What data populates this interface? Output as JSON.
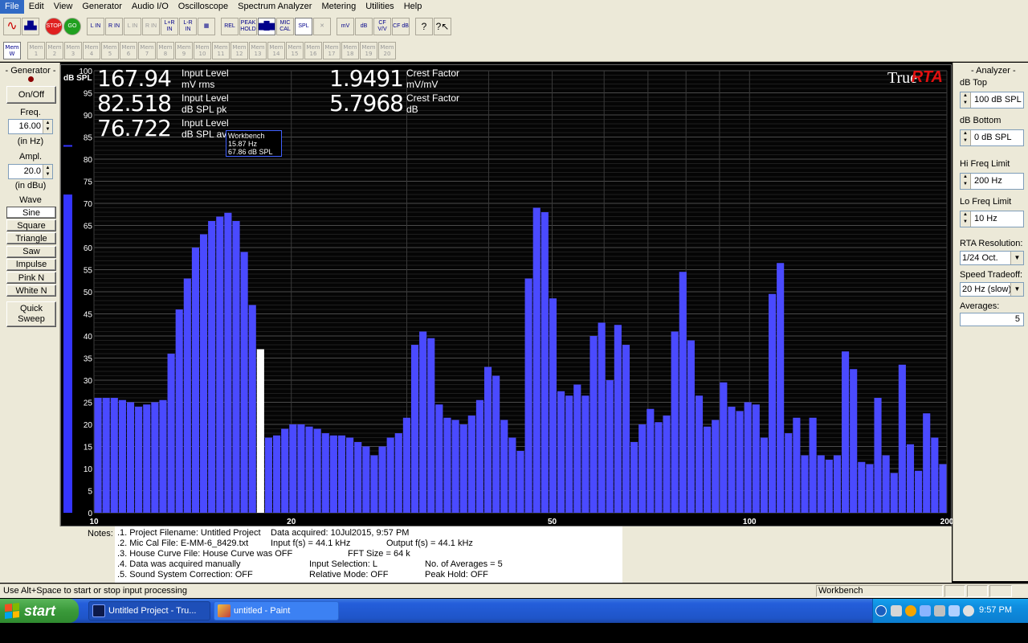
{
  "menu": [
    "File",
    "Edit",
    "View",
    "Generator",
    "Audio I/O",
    "Oscilloscope",
    "Spectrum Analyzer",
    "Metering",
    "Utilities",
    "Help"
  ],
  "toolbar": {
    "row1": [
      {
        "name": "sine-wave-icon",
        "label": "∿",
        "state": "normal"
      },
      {
        "name": "spectrum-icon",
        "label": "▟▙",
        "state": "normal"
      },
      {
        "sep": true
      },
      {
        "name": "stop-icon",
        "label": "STOP",
        "state": "normal"
      },
      {
        "name": "go-icon",
        "label": "GO",
        "state": "normal"
      },
      {
        "sep": true
      },
      {
        "name": "left-input-icon",
        "label": "L IN",
        "state": "normal"
      },
      {
        "name": "right-input-icon",
        "label": "R IN",
        "state": "normal"
      },
      {
        "name": "left-input-alt-icon",
        "label": "L IN",
        "state": "disabled"
      },
      {
        "name": "right-input-alt-icon",
        "label": "R IN",
        "state": "disabled"
      },
      {
        "name": "l-plus-r-input-icon",
        "label": "L+R IN",
        "state": "normal"
      },
      {
        "name": "l-minus-r-input-icon",
        "label": "L-R IN",
        "state": "normal"
      },
      {
        "name": "grid-icon",
        "label": "▦",
        "state": "normal"
      },
      {
        "sep": true
      },
      {
        "name": "relative-icon",
        "label": "REL",
        "state": "normal"
      },
      {
        "name": "peak-hold-icon",
        "label": "PEAK HOLD",
        "state": "normal"
      },
      {
        "name": "bar-graph-icon",
        "label": "▆█▆",
        "state": "pressed"
      },
      {
        "name": "mic-cal-icon",
        "label": "MIC CAL",
        "state": "normal"
      },
      {
        "name": "spl-icon",
        "label": "SPL",
        "state": "pressed"
      },
      {
        "name": "clear-icon",
        "label": "✕",
        "state": "disabled"
      },
      {
        "sep": true
      },
      {
        "name": "millivolt-icon",
        "label": "mV",
        "state": "normal"
      },
      {
        "name": "decibel-icon",
        "label": "dB",
        "state": "normal"
      },
      {
        "name": "crest-factor-vv-icon",
        "label": "CF V/V",
        "state": "normal"
      },
      {
        "name": "crest-factor-db-icon",
        "label": "CF dB",
        "state": "normal"
      },
      {
        "sep": true
      },
      {
        "name": "help-icon",
        "label": "?",
        "state": "normal"
      },
      {
        "name": "context-help-icon",
        "label": "?↖",
        "state": "normal"
      }
    ],
    "mem_buttons": [
      "Mem W",
      "Mem 1",
      "Mem 2",
      "Mem 3",
      "Mem 4",
      "Mem 5",
      "Mem 6",
      "Mem 7",
      "Mem 8",
      "Mem 9",
      "Mem 10",
      "Mem 11",
      "Mem 12",
      "Mem 13",
      "Mem 14",
      "Mem 15",
      "Mem 16",
      "Mem 17",
      "Mem 18",
      "Mem 19",
      "Mem 20"
    ]
  },
  "generator": {
    "title": "- Generator -",
    "onoff": "On/Off",
    "freq_label": "Freq.",
    "freq_value": "16.00",
    "freq_unit": "(in Hz)",
    "ampl_label": "Ampl.",
    "ampl_value": "20.0",
    "ampl_unit": "(in dBu)",
    "wave_label": "Wave",
    "waves": [
      "Sine",
      "Square",
      "Triangle",
      "Saw",
      "Impulse",
      "Pink N",
      "White N"
    ],
    "quick_sweep_1": "Quick",
    "quick_sweep_2": "Sweep"
  },
  "readouts": {
    "r1_value": "167.94",
    "r1_label1": "Input Level",
    "r1_label2": "mV rms",
    "r2_value": "82.518",
    "r2_label1": "Input Level",
    "r2_label2": "dB SPL pk",
    "r3_value": "76.722",
    "r3_label1": "Input Level",
    "r3_label2": "dB SPL avg",
    "c1_value": "1.9491",
    "c1_label1": "Crest Factor",
    "c1_label2": "mV/mV",
    "c2_value": "5.7968",
    "c2_label1": "Crest Factor",
    "c2_label2": "dB"
  },
  "logo": {
    "part1": "True",
    "part2": "RTA"
  },
  "tooltip": {
    "line1": "Workbench",
    "line2": "15.87 Hz",
    "line3": "67.86 dB SPL"
  },
  "colors": {
    "bar": "#4a4aff",
    "highlight": "#ffffff",
    "grid": "#3a3a3a",
    "meter": "#3535ff"
  },
  "chart_data": {
    "type": "bar",
    "title": "",
    "ylabel": "dB SPL",
    "xlabel": "",
    "ylim": [
      0,
      100
    ],
    "y_ticks": [
      0,
      5,
      10,
      15,
      20,
      25,
      30,
      35,
      40,
      45,
      50,
      55,
      60,
      65,
      70,
      75,
      80,
      85,
      90,
      95,
      100
    ],
    "x_tick_labels": [
      {
        "freq": 10,
        "label": "10"
      },
      {
        "freq": 20,
        "label": "20"
      },
      {
        "freq": 50,
        "label": "50"
      },
      {
        "freq": 100,
        "label": "100"
      },
      {
        "freq": 200,
        "label": "200"
      }
    ],
    "xlim_hz": [
      10,
      200
    ],
    "x_scale": "log",
    "resolution": "1/24 Oct.",
    "highlight_index": 20,
    "meter_level_db": 72,
    "meter_marker_db": 83,
    "values": [
      26,
      26,
      26,
      25.5,
      25,
      24,
      24.5,
      25,
      25.5,
      36,
      46,
      53,
      60,
      63,
      66,
      67,
      67.86,
      66,
      59,
      47,
      37,
      17,
      17.5,
      19,
      20,
      20,
      19.5,
      19,
      18,
      17.5,
      17.5,
      17,
      16,
      15,
      13,
      15,
      17,
      18,
      21.5,
      38,
      41,
      39.5,
      24.5,
      21.5,
      21,
      20,
      22,
      25.5,
      33,
      31,
      21,
      17,
      14,
      53,
      69,
      68,
      48.5,
      27.5,
      26.5,
      29,
      26.5,
      40,
      43,
      30,
      42.5,
      38,
      16,
      20,
      23.5,
      20.5,
      22,
      41,
      54.5,
      39,
      26.5,
      19.5,
      21,
      29.5,
      24,
      23,
      25,
      24.5,
      17,
      49.5,
      56.5,
      18,
      21.5,
      13,
      21.5,
      13,
      12,
      13,
      36.5,
      32.5,
      11.5,
      11,
      26,
      13,
      9,
      33.5,
      15.5,
      9.5,
      22.5,
      17,
      11
    ]
  },
  "notes": {
    "label": "Notes:",
    "line1_a": ".1. Project Filename: Untitled Project",
    "line1_b": "Data acquired: 10Jul2015, 9:57 PM",
    "line2_a": ".2. Mic Cal File: E-MM-6_8429.txt",
    "line2_b": "Input f(s) = 44.1 kHz",
    "line2_c": "Output f(s) = 44.1 kHz",
    "line3_a": ".3. House Curve File: House Curve was OFF",
    "line3_b": "FFT Size = 64 k",
    "line4_a": ".4. Data was acquired manually",
    "line4_b": "Input Selection: L",
    "line4_c": "No. of Averages = 5",
    "line5_a": ".5. Sound System Correction: OFF",
    "line5_b": "Relative Mode:  OFF",
    "line5_c": "Peak Hold: OFF"
  },
  "analyzer": {
    "title": "- Analyzer -",
    "db_top_label": "dB Top",
    "db_top_value": "100 dB SPL",
    "db_bottom_label": "dB Bottom",
    "db_bottom_value": "0 dB SPL",
    "hi_freq_label": "Hi Freq Limit",
    "hi_freq_value": "200 Hz",
    "lo_freq_label": "Lo Freq Limit",
    "lo_freq_value": "10 Hz",
    "resolution_label": "RTA Resolution:",
    "resolution_value": "1/24 Oct.",
    "speed_label": "Speed Tradeoff:",
    "speed_value": "20 Hz (slow)",
    "averages_label": "Averages:",
    "averages_value": "5"
  },
  "status": {
    "text": "Use Alt+Space to start or stop input processing",
    "pane": "Workbench"
  },
  "taskbar": {
    "start": "start",
    "task1": "Untitled Project - Tru...",
    "task2": "untitled - Paint",
    "clock": "9:57 PM"
  }
}
